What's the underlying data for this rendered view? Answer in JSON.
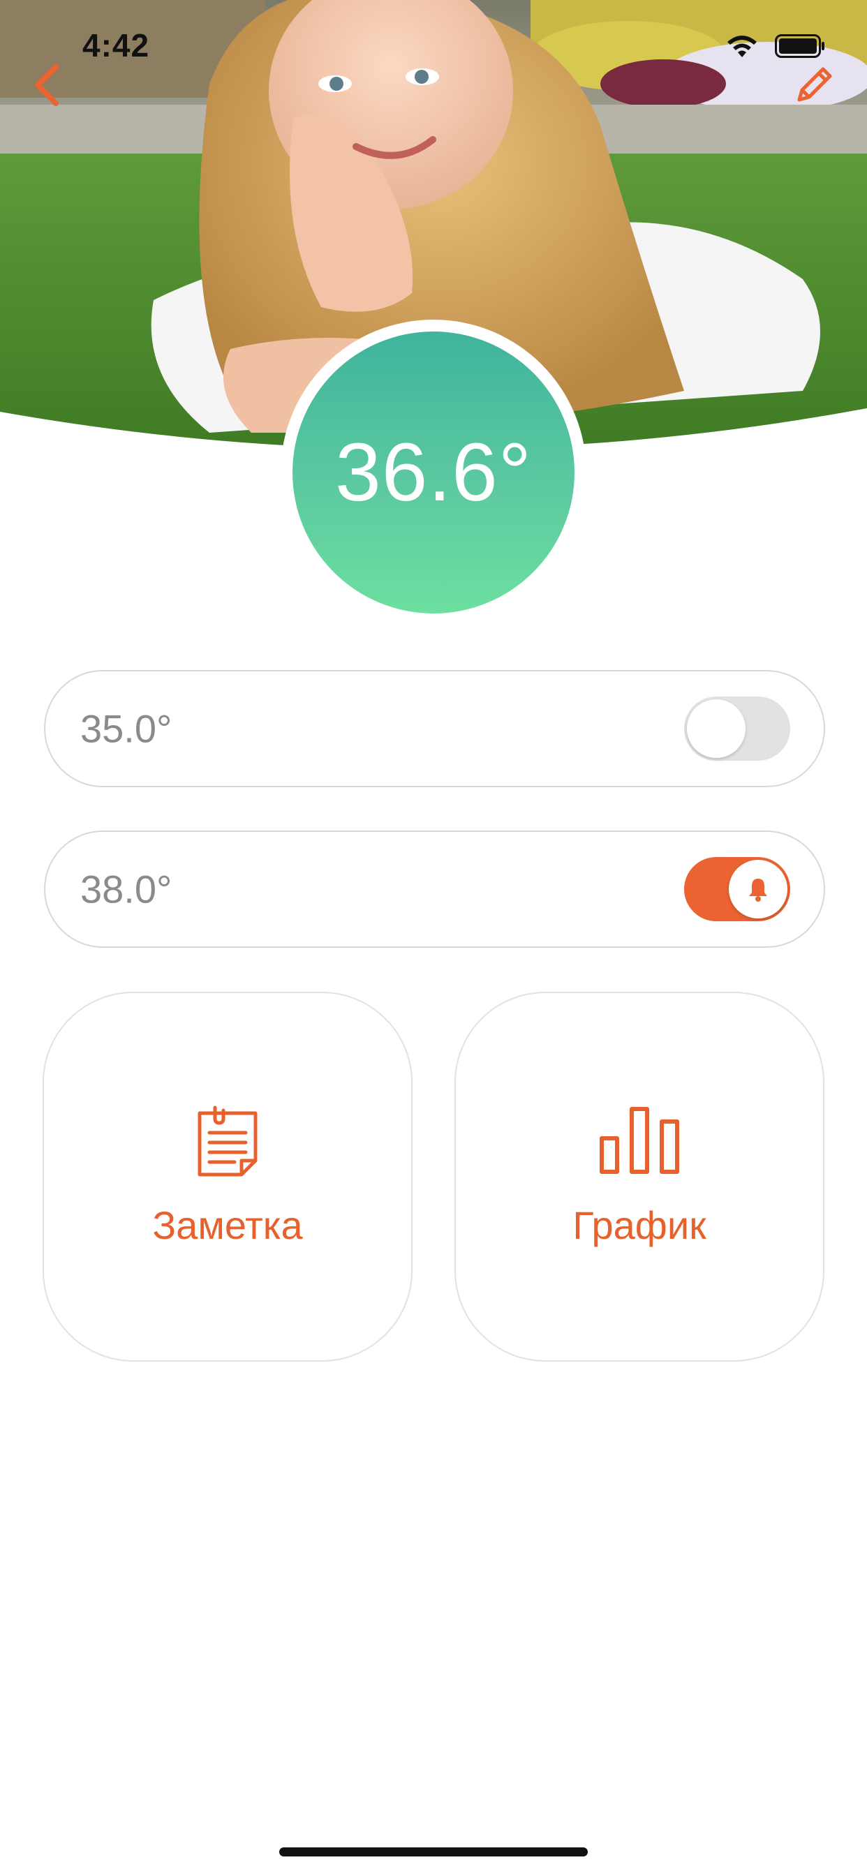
{
  "status_bar": {
    "time": "4:42"
  },
  "nav": {
    "back_icon": "chevron-left-icon",
    "edit_icon": "pencil-icon"
  },
  "current_temperature": "36.6°",
  "thresholds": {
    "low": {
      "value": "35.0°",
      "enabled": false
    },
    "high": {
      "value": "38.0°",
      "enabled": true,
      "icon": "bell-icon"
    }
  },
  "actions": {
    "note": {
      "label": "Заметка",
      "icon": "clipboard-note-icon"
    },
    "chart": {
      "label": "График",
      "icon": "bar-chart-icon"
    }
  },
  "colors": {
    "accent": "#ea6330",
    "temperature_gradient_top": "#3fb49d",
    "temperature_gradient_bottom": "#6ddfa0",
    "card_border": "#e2e2e2",
    "muted_text": "#8a8a8a"
  }
}
